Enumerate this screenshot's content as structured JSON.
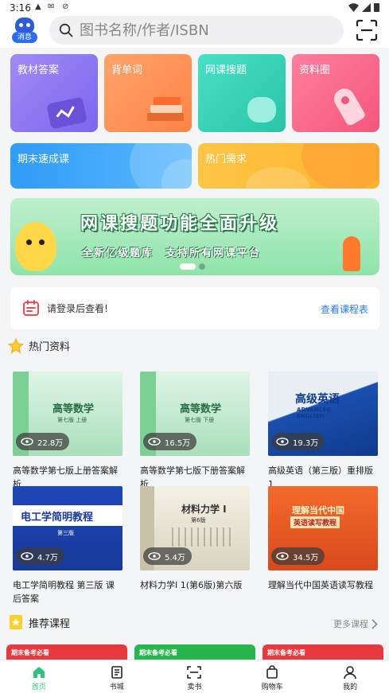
{
  "status": {
    "time": "3:16"
  },
  "header": {
    "message_badge": "消息",
    "search_placeholder": "图书名称/作者/ISBN"
  },
  "features": [
    {
      "label": "教材答案",
      "color": "#8f78f2"
    },
    {
      "label": "背单词",
      "color": "#ff9158"
    },
    {
      "label": "网课搜题",
      "color": "#3cd4b8"
    },
    {
      "label": "资料圈",
      "color": "#f86a8c"
    },
    {
      "label": "期末速成课",
      "color": "#3aa6fa"
    },
    {
      "label": "热门需求",
      "color": "#ffbd3a"
    }
  ],
  "banner": {
    "title": "网课搜题功能全面升级",
    "subtitle": "全新亿级题库　支持所有网课平台",
    "active_slide": 1,
    "slide_count": 2
  },
  "course_strip": {
    "tip": "请登录后查看!",
    "link": "查看课程表"
  },
  "hot_section": {
    "title": "热门资料"
  },
  "books": [
    {
      "title": "高等数学第七版上册答案解析",
      "views": "22.8万",
      "cover_text": "高等数学",
      "cover_sub": "第七版 上册"
    },
    {
      "title": "高等数学第七版下册答案解析",
      "views": "16.5万",
      "cover_text": "高等数学",
      "cover_sub": "第七版 下册"
    },
    {
      "title": "高级英语（第三版）重排版1",
      "views": "19.3万",
      "cover_text": "高级英语",
      "cover_sub": "ADVANCED ENGLISH"
    },
    {
      "title": "电工学简明教程 第三版 课后答案",
      "views": "4.7万",
      "cover_text": "电工学简明教程",
      "cover_sub": "第三版"
    },
    {
      "title": "材料力学I 1(第6版)第六版",
      "views": "5.4万",
      "cover_text": "材料力学 I",
      "cover_sub": "第6版"
    },
    {
      "title": "理解当代中国英语读写教程",
      "views": "34.5万",
      "cover_text": "理解当代中国",
      "cover_sub": "英语读写教程"
    }
  ],
  "recommend_section": {
    "title": "推荐课程",
    "more": "更多课程"
  },
  "recommend_cards": [
    {
      "label": "期末备考必看",
      "color": "#e8393f"
    },
    {
      "label": "期末备考必看",
      "color": "#27b64b"
    },
    {
      "label": "期末备考必看",
      "color": "#e8393f"
    }
  ],
  "tabs": [
    {
      "label": "首页",
      "icon": "home-icon",
      "active": true
    },
    {
      "label": "书城",
      "icon": "bookstore-icon",
      "active": false
    },
    {
      "label": "卖书",
      "icon": "scan-sell-icon",
      "active": false
    },
    {
      "label": "购物车",
      "icon": "cart-icon",
      "active": false
    },
    {
      "label": "我的",
      "icon": "profile-icon",
      "active": false
    }
  ]
}
